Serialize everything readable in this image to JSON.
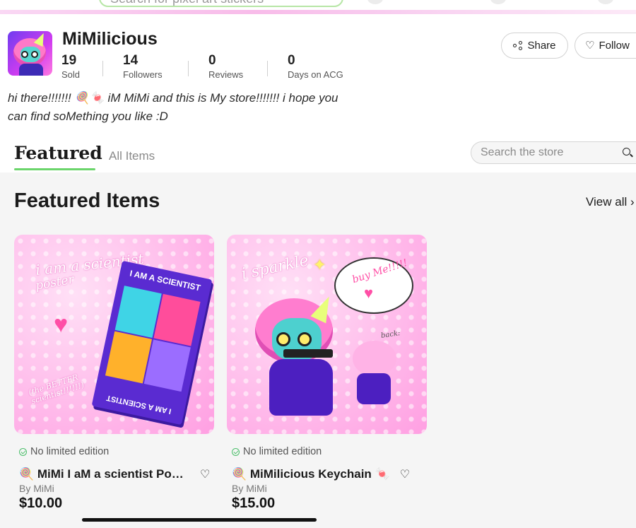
{
  "topbar": {
    "search_placeholder": "Search for pixel art stickers"
  },
  "store": {
    "name": "MiMilicious",
    "stats": [
      {
        "value": "19",
        "label": "Sold"
      },
      {
        "value": "14",
        "label": "Followers"
      },
      {
        "value": "0",
        "label": "Reviews"
      },
      {
        "value": "0",
        "label": "Days on ACG"
      }
    ],
    "share_label": "Share",
    "follow_label": "Follow",
    "bio_line1": "hi there!!!!!!! 🍭🍬 iM MiMi and this is My store!!!!!!! i hope you",
    "bio_line2": "can find soMething you like :D"
  },
  "tabs": {
    "featured": "Featured",
    "all_items": "All Items"
  },
  "store_search": {
    "placeholder": "Search the store"
  },
  "section": {
    "title": "Featured Items",
    "view_all": "View all"
  },
  "products": [
    {
      "limited": "No limited edition",
      "title": "🍭 MiMi I aM a scientist Poster",
      "by": "By MiMi",
      "price": "$10.00",
      "art": {
        "scrawl_1": "i am a scientist",
        "scrawl_2": "poster",
        "poster_header": "I AM A SCIENTIST",
        "poster_footer": "I AM A SCIENTIST",
        "scrawl_3": "(the BETTER scientist!!!!!!)"
      }
    },
    {
      "limited": "No limited edition",
      "title": "🍭 MiMilicious Keychain 🍬",
      "by": "By MiMi",
      "price": "$15.00",
      "art": {
        "scrawl_1": "i sparkle",
        "bubble": "buy Me!!!!!",
        "back": "back:"
      }
    }
  ],
  "icons": {
    "share": "share-icon",
    "heart": "heart-icon",
    "search": "search-icon",
    "check": "check-circle-icon"
  },
  "colors": {
    "accent_green": "#6bd56b",
    "check_green": "#4cbf6b",
    "pink": "#ff9fe2"
  }
}
